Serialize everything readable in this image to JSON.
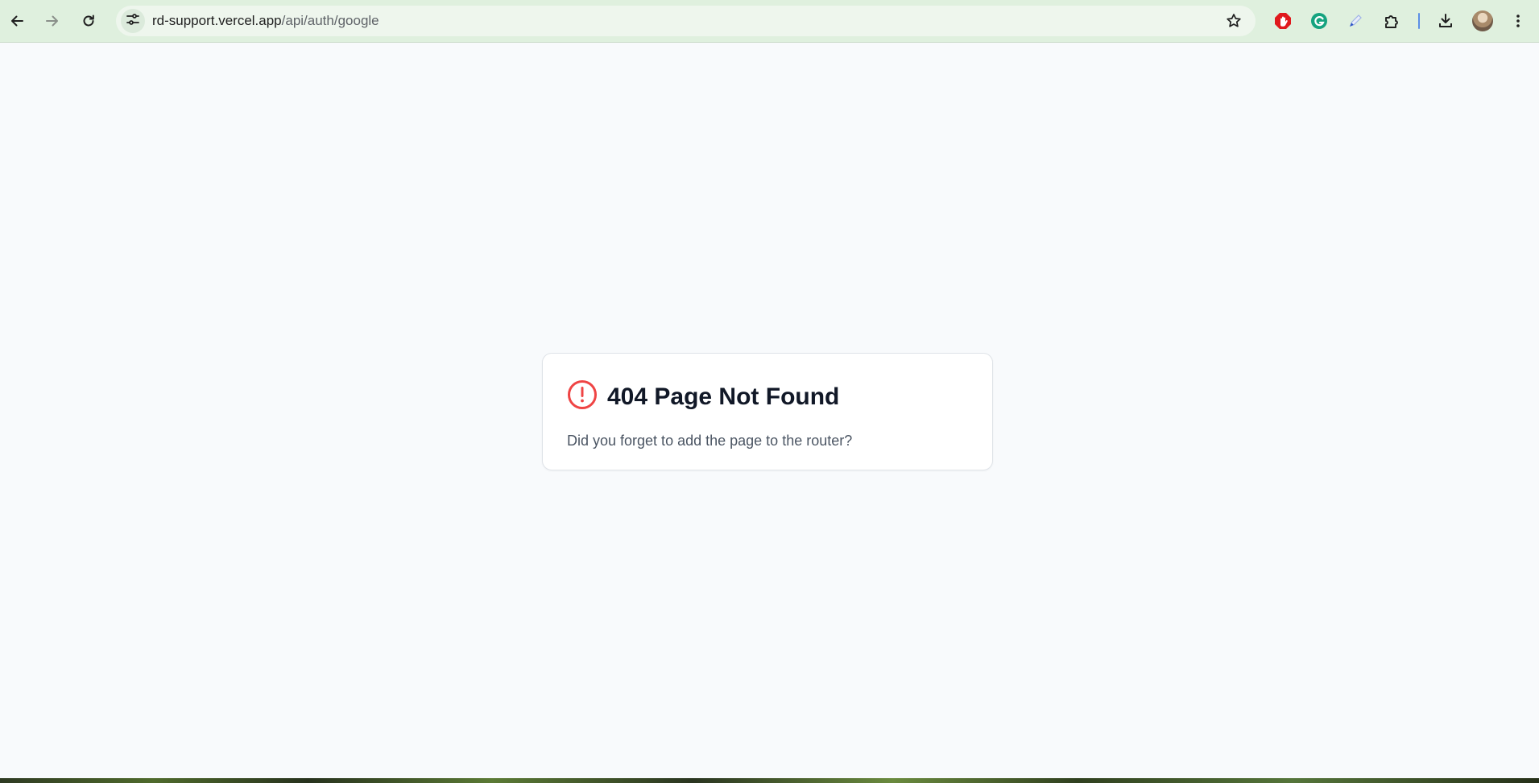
{
  "browser": {
    "url_host": "rd-support.vercel.app",
    "url_path": "/api/auth/google",
    "icons": {
      "back": "arrow-left-icon",
      "forward": "arrow-right-icon",
      "reload": "reload-icon",
      "site_info": "tune-icon",
      "bookmark": "star-icon",
      "ext_1": "adblock-hand-icon",
      "ext_2": "grammarly-icon",
      "ext_3": "pen-icon",
      "extensions": "puzzle-icon",
      "downloads": "download-icon",
      "profile": "avatar",
      "menu": "kebab-menu-icon"
    },
    "colors": {
      "toolbar_bg": "#dff0de",
      "omnibox_bg": "#eef6ed"
    }
  },
  "page": {
    "error": {
      "title": "404 Page Not Found",
      "message": "Did you forget to add the page to the router?",
      "icon": "alert-circle-icon",
      "icon_color": "#ef4444"
    },
    "background": "#f8fafc"
  }
}
